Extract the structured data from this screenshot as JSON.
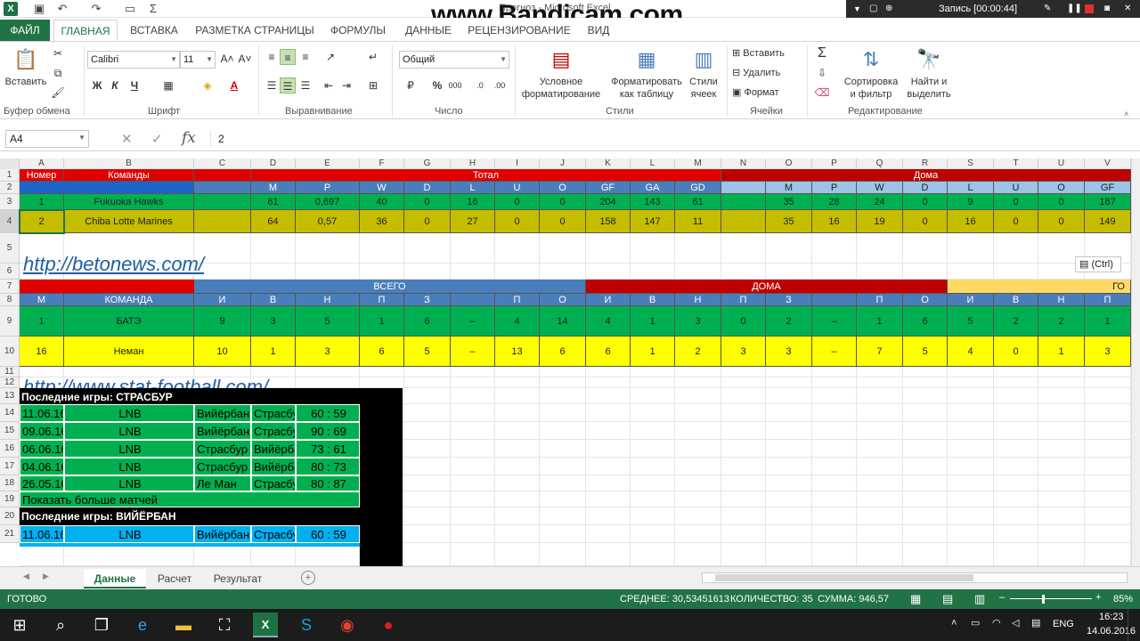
{
  "window": {
    "title": "Прогноз - Microsoft Excel"
  },
  "watermark": "www.Bandicam.com",
  "recorder": {
    "label": "Запись [00:00:44]"
  },
  "ribbon_tabs": {
    "file": "ФАЙЛ",
    "home": "ГЛАВНАЯ",
    "insert": "ВСТАВКА",
    "layout": "РАЗМЕТКА СТРАНИЦЫ",
    "formulas": "ФОРМУЛЫ",
    "data": "ДАННЫЕ",
    "review": "РЕЦЕНЗИРОВАНИЕ",
    "view": "ВИД"
  },
  "ribbon": {
    "paste": "Вставить",
    "clipboard_group": "Буфер обмена",
    "font_name": "Calibri",
    "font_size": "11",
    "bold": "Ж",
    "italic": "К",
    "underline": "Ч",
    "font_group": "Шрифт",
    "align_group": "Выравнивание",
    "number_format": "Общий",
    "number_group": "Число",
    "cond_format_1": "Условное",
    "cond_format_2": "форматирование",
    "format_table_1": "Форматировать",
    "format_table_2": "как таблицу",
    "cell_styles_1": "Стили",
    "cell_styles_2": "ячеек",
    "styles_group": "Стили",
    "insert_cells": "Вставить",
    "delete_cells": "Удалить",
    "format_cells": "Формат",
    "cells_group": "Ячейки",
    "sort_1": "Сортировка",
    "sort_2": "и фильтр",
    "find_1": "Найти и",
    "find_2": "выделить",
    "edit_group": "Редактирование"
  },
  "formula_bar": {
    "name_box": "A4",
    "value": "2"
  },
  "columns": [
    "A",
    "B",
    "C",
    "D",
    "E",
    "F",
    "G",
    "H",
    "I",
    "J",
    "K",
    "L",
    "M",
    "N",
    "O",
    "P",
    "Q",
    "R",
    "S",
    "T",
    "U",
    "V"
  ],
  "rows": [
    "1",
    "2",
    "3",
    "4",
    "5",
    "6",
    "7",
    "8",
    "9",
    "10",
    "11",
    "12",
    "13",
    "14",
    "15",
    "16",
    "17",
    "18",
    "19",
    "20",
    "21"
  ],
  "table1": {
    "header1": {
      "num": "Номер",
      "teams": "Команды",
      "total": "Тотал",
      "home": "Дома"
    },
    "header2": [
      "M",
      "P",
      "W",
      "D",
      "L",
      "U",
      "O",
      "GF",
      "GA",
      "GD"
    ],
    "header2_home": [
      "M",
      "P",
      "W",
      "D",
      "L",
      "U",
      "O",
      "GF"
    ],
    "rows": [
      {
        "num": "1",
        "team": "Fukuoka Hawks",
        "vals": [
          "61",
          "0,697",
          "40",
          "0",
          "16",
          "0",
          "0",
          "204",
          "143",
          "61"
        ],
        "home": [
          "35",
          "28",
          "24",
          "0",
          "9",
          "0",
          "0",
          "187"
        ]
      },
      {
        "num": "2",
        "team": "Chiba Lotte Marines",
        "vals": [
          "64",
          "0,57",
          "36",
          "0",
          "27",
          "0",
          "0",
          "158",
          "147",
          "11"
        ],
        "home": [
          "35",
          "16",
          "19",
          "0",
          "16",
          "0",
          "0",
          "149"
        ]
      }
    ]
  },
  "link1": "http://betonews.com/",
  "paste_options": "(Ctrl)",
  "table2": {
    "header1": {
      "total": "ВСЕГО",
      "home": "ДОМА",
      "away": "ГО"
    },
    "header2": [
      "М",
      "КОМАНДА",
      "И",
      "В",
      "Н",
      "П",
      "З",
      "",
      "П",
      "О",
      "И",
      "В",
      "Н",
      "П",
      "З",
      "",
      "П",
      "О",
      "И",
      "В",
      "Н",
      "П"
    ],
    "rows": [
      [
        "1",
        "БАТЭ",
        "9",
        "3",
        "5",
        "1",
        "6",
        "–",
        "4",
        "14",
        "4",
        "1",
        "3",
        "0",
        "2",
        "–",
        "1",
        "6",
        "5",
        "2",
        "2",
        "1"
      ],
      [
        "16",
        "Неман",
        "10",
        "1",
        "3",
        "6",
        "5",
        "–",
        "13",
        "6",
        "6",
        "1",
        "2",
        "3",
        "3",
        "–",
        "7",
        "5",
        "4",
        "0",
        "1",
        "3"
      ]
    ]
  },
  "link2": "http://www.stat-football.com/",
  "games1": {
    "title": "Последние игры: СТРАСБУР",
    "rows": [
      [
        "11.06.16",
        "LNB",
        "Вийёрбан",
        "Страсбур",
        "60 : 59"
      ],
      [
        "09.06.16",
        "LNB",
        "Вийёрбан",
        "Страсбур",
        "90 : 69"
      ],
      [
        "06.06.16",
        "LNB",
        "Страсбур",
        "Вийёрбан",
        "73 : 61"
      ],
      [
        "04.06.16",
        "LNB",
        "Страсбур",
        "Вийёрбан",
        "80 : 73"
      ],
      [
        "26.05.16",
        "LNB",
        "Ле Ман",
        "Страсбур",
        "80 : 87"
      ]
    ],
    "more": "Показать больше матчей"
  },
  "games2": {
    "title": "Последние игры: ВИЙЁРБАН",
    "rows": [
      [
        "11.06.16",
        "LNB",
        "Вийёрбан",
        "Страсбур",
        "60 : 59"
      ]
    ]
  },
  "sheets": [
    "Данные",
    "Расчет",
    "Результат"
  ],
  "status": {
    "ready": "ГОТОВО",
    "average": "СРЕДНЕЕ: 30,53451613",
    "count": "КОЛИЧЕСТВО: 35",
    "sum": "СУММА: 946,57",
    "zoom": "85%"
  },
  "taskbar": {
    "lang": "ENG",
    "time": "16:23",
    "date": "14.06.2016"
  },
  "colors": {
    "excel_green": "#217346",
    "red": "#e00000",
    "dark_red": "#c00000",
    "blue": "#1f64c8",
    "steel_blue": "#4a7ebb",
    "green": "#00b050",
    "olive": "#c4bd00",
    "yellow": "#ffff00",
    "light_blue": "#9dc3e6",
    "cyan": "#00b0f0",
    "pale_gold": "#ffd966"
  }
}
